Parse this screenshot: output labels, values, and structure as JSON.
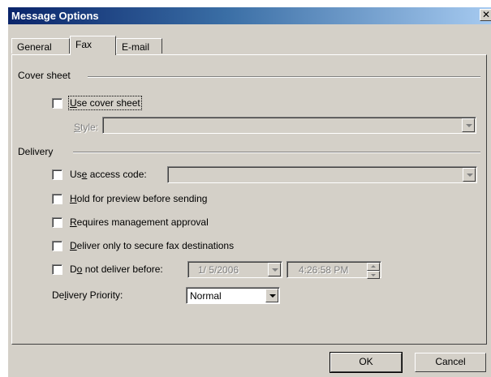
{
  "window": {
    "title": "Message Options",
    "close_glyph": "✕"
  },
  "tabs": [
    {
      "label": "General"
    },
    {
      "label": "Fax"
    },
    {
      "label": "E-mail"
    }
  ],
  "cover_sheet": {
    "group_label": "Cover sheet",
    "use_cover_sheet": {
      "pre": "",
      "acc": "U",
      "post": "se cover sheet",
      "checked": false
    },
    "style": {
      "acc": "S",
      "post": "tyle:",
      "value": ""
    }
  },
  "delivery": {
    "group_label": "Delivery",
    "use_access_code": {
      "pre": "Us",
      "acc": "e",
      "post": " access code:",
      "checked": false,
      "value": ""
    },
    "hold_preview": {
      "pre": "",
      "acc": "H",
      "post": "old for preview before sending",
      "checked": false
    },
    "requires_approval": {
      "pre": "",
      "acc": "R",
      "post": "equires management approval",
      "checked": false
    },
    "secure_fax": {
      "pre": "",
      "acc": "D",
      "post": "eliver only to secure fax destinations",
      "checked": false
    },
    "do_not_deliver": {
      "pre": "D",
      "acc": "o",
      "post": " not deliver before:",
      "checked": false,
      "date": "1/ 5/2006",
      "time": "4:26:58 PM"
    },
    "priority": {
      "pre": "De",
      "acc": "l",
      "post": "ivery Priority:",
      "value": "Normal"
    }
  },
  "buttons": {
    "ok": "OK",
    "cancel": "Cancel"
  }
}
